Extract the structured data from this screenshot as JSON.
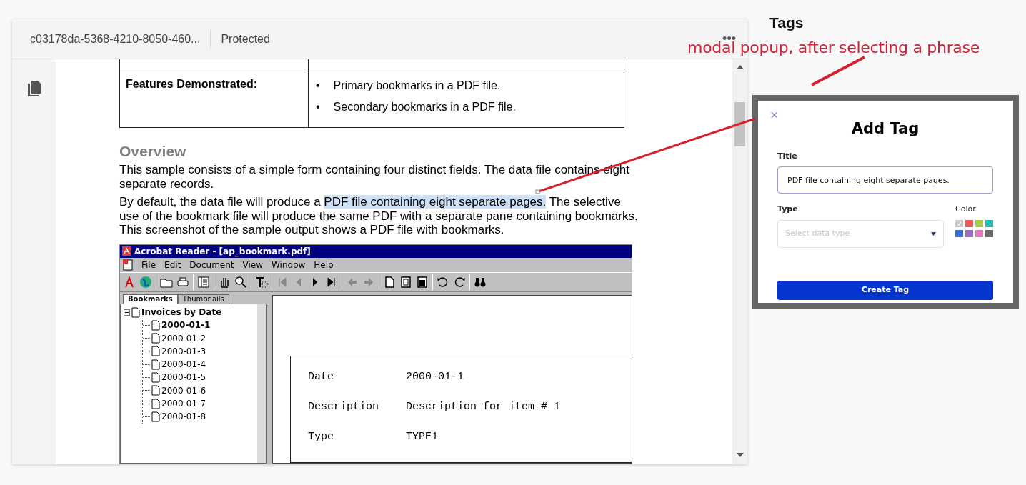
{
  "viewer": {
    "file_name": "c03178da-5368-4210-8050-460...",
    "status": "Protected",
    "more": "•••"
  },
  "document": {
    "features_label": "Features Demonstrated:",
    "features": [
      {
        "bullet": "•",
        "text": "Primary bookmarks in a PDF file."
      },
      {
        "bullet": "•",
        "text": "Secondary bookmarks in a PDF file."
      }
    ],
    "heading": "Overview",
    "paragraphs": [
      [
        {
          "text": "This sample consists of a simple form containing four distinct fields. The data file contains eight separate records.",
          "highlighted": false
        }
      ],
      [
        {
          "text": "By default, the data file will produce a ",
          "highlighted": false
        },
        {
          "text": "PDF file containing eight separate pages.",
          "highlighted": true
        },
        {
          "text": " The selective use of the bookmark file will produce the same PDF with a separate pane containing bookmarks. This screenshot of the sample output shows a PDF file with bookmarks.",
          "highlighted": false
        }
      ]
    ],
    "embedded_window": {
      "title": "Acrobat Reader - [ap_bookmark.pdf]",
      "menu": [
        "File",
        "Edit",
        "Document",
        "View",
        "Window",
        "Help"
      ],
      "tabs": [
        {
          "label": "Bookmarks",
          "selected": true
        },
        {
          "label": "Thumbnails",
          "selected": false
        }
      ],
      "tree": [
        {
          "label": "Invoices by Date",
          "expanded": true,
          "children": [
            {
              "label": "2000-01-1",
              "selected": true
            },
            {
              "label": "2000-01-2",
              "selected": false
            },
            {
              "label": "2000-01-3",
              "selected": false
            },
            {
              "label": "2000-01-4",
              "selected": false
            },
            {
              "label": "2000-01-5",
              "selected": false
            },
            {
              "label": "2000-01-6",
              "selected": false
            },
            {
              "label": "2000-01-7",
              "selected": false
            },
            {
              "label": "2000-01-8",
              "selected": false
            }
          ]
        }
      ],
      "fields": [
        {
          "label": "Date",
          "value": "2000-01-1"
        },
        {
          "label": "Description",
          "value": "Description for item # 1"
        },
        {
          "label": "Type",
          "value": "TYPE1"
        }
      ]
    }
  },
  "tags_panel": {
    "title": "Tags"
  },
  "annotation": {
    "text": "modal popup, after selecting a phrase"
  },
  "modal": {
    "close": "×",
    "title": "Add Tag",
    "title_label": "Title",
    "title_value": "PDF file containing eight separate pages.",
    "type_label": "Type",
    "type_placeholder": "Select data type",
    "color_label": "Color",
    "swatches": [
      {
        "color": "#c8c8c8",
        "selected": true
      },
      {
        "color": "#ee5a5a",
        "selected": false
      },
      {
        "color": "#a8cc4a",
        "selected": false
      },
      {
        "color": "#2bb8b0",
        "selected": false
      },
      {
        "color": "#3a6fd8",
        "selected": false
      },
      {
        "color": "#9b6cc4",
        "selected": false
      },
      {
        "color": "#e27ab8",
        "selected": false
      },
      {
        "color": "#6a6a6a",
        "selected": false
      }
    ],
    "button": "Create Tag"
  }
}
